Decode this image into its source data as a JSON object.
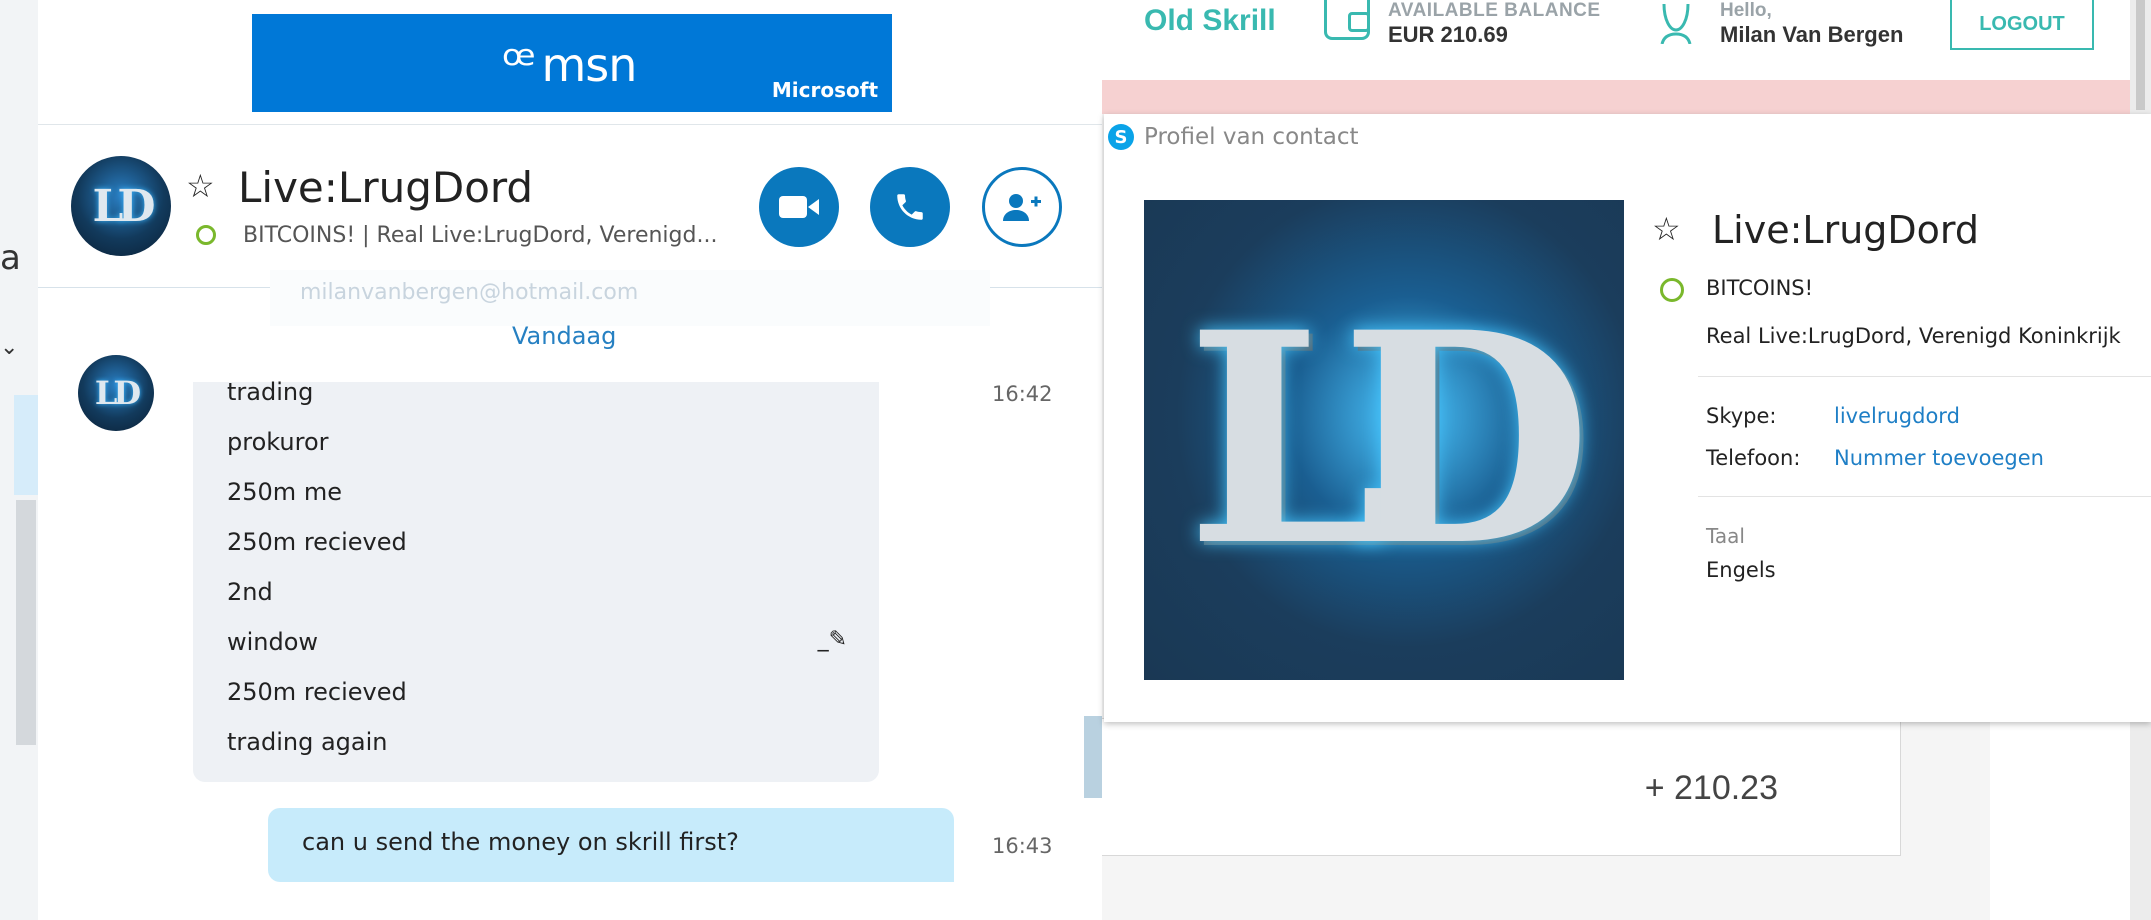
{
  "chat": {
    "banner": {
      "brand": "msn",
      "company": "Microsoft"
    },
    "contact": {
      "name": "Live:LrugDord",
      "mood": "BITCOINS!  |  Real Live:LrugDord, Verenigd..."
    },
    "ghost_email": "milanvanbergen@hotmail.com",
    "date_separator": "Vandaag",
    "incoming": {
      "time": "16:42",
      "lines": [
        "trading",
        "prokuror",
        "250m me",
        "250m recieved",
        "2nd",
        "window",
        "250m recieved",
        "trading again"
      ]
    },
    "outgoing": {
      "text": "can u send the money on skrill first?",
      "time": "16:43"
    },
    "icons": {
      "video": "video-call-icon",
      "call": "phone-call-icon",
      "add": "add-contact-icon",
      "favorite": "star-icon",
      "status": "online-status-icon",
      "edited": "edit-pencil-icon"
    }
  },
  "skrill": {
    "brand": "Old Skrill",
    "balance_label": "AVAILABLE BALANCE",
    "balance_value": "EUR 210.69",
    "hello": "Hello,",
    "user_name": "Milan Van Bergen",
    "logout": "LOGOUT",
    "amount": "+ 210.23",
    "accent": "#39b9b0"
  },
  "profile": {
    "title": "Profiel van contact",
    "name": "Live:LrugDord",
    "mood": "BITCOINS!",
    "location": "Real Live:LrugDord, Verenigd Koninkrijk",
    "skype_label": "Skype:",
    "skype_value": "livelrugdord",
    "phone_label": "Telefoon:",
    "phone_value": "Nummer toevoegen",
    "language_label": "Taal",
    "language_value": "Engels"
  }
}
